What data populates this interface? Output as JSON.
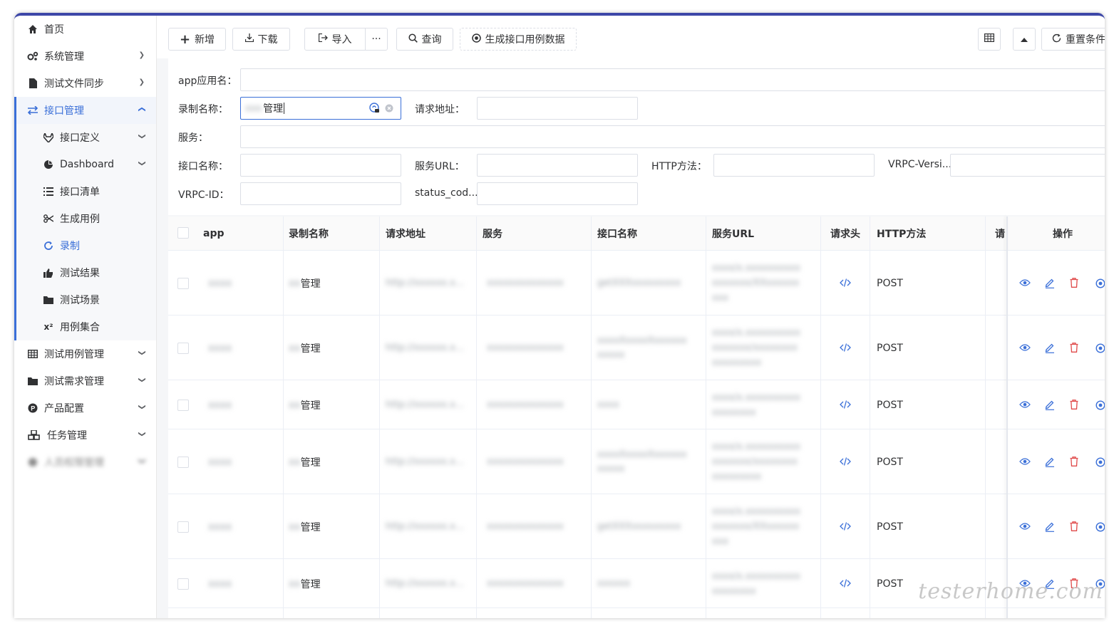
{
  "sidebar": {
    "items": [
      {
        "label": "首页",
        "icon": "home-icon"
      },
      {
        "label": "系统管理",
        "icon": "gears-icon"
      },
      {
        "label": "测试文件同步",
        "icon": "file-icon"
      },
      {
        "label": "接口管理",
        "icon": "exchange-icon"
      },
      {
        "label": "接口定义",
        "icon": "gitlab-icon"
      },
      {
        "label": "Dashboard",
        "icon": "pie-chart-icon"
      },
      {
        "label": "接口清单",
        "icon": "list-icon"
      },
      {
        "label": "生成用例",
        "icon": "scissors-icon"
      },
      {
        "label": "录制",
        "icon": "refresh-icon"
      },
      {
        "label": "测试结果",
        "icon": "thumbs-up-icon"
      },
      {
        "label": "测试场景",
        "icon": "folder-icon"
      },
      {
        "label": "用例集合",
        "icon": "superscript-icon"
      },
      {
        "label": "测试用例管理",
        "icon": "table-icon"
      },
      {
        "label": "测试需求管理",
        "icon": "folder-icon"
      },
      {
        "label": "产品配置",
        "icon": "product-hunt-icon"
      },
      {
        "label": "任务管理",
        "icon": "cubes-icon"
      },
      {
        "label": "人员权限管理",
        "icon": "blurred-icon"
      }
    ]
  },
  "toolbar": {
    "add": "新增",
    "download": "下载",
    "import": "导入",
    "more": "···",
    "query": "查询",
    "generate": "生成接口用例数据",
    "reset": "重置条件"
  },
  "search": {
    "app_label": "app应用名：",
    "record_label": "录制名称：",
    "record_value": "管理",
    "record_prefix": "xxx",
    "url_label": "请求地址：",
    "service_label": "服务：",
    "iface_label": "接口名称：",
    "service_url_label": "服务URL：",
    "http_label": "HTTP方法：",
    "vrpc_ver_label": "VRPC-Versi...",
    "vrpc_id_label": "VRPC-ID：",
    "status_label": "status_cod..."
  },
  "table": {
    "headers": [
      "app",
      "录制名称",
      "请求地址",
      "服务",
      "接口名称",
      "服务URL",
      "请求头",
      "HTTP方法",
      "请",
      "操作"
    ],
    "rows": [
      {
        "app": "xxxx",
        "record_prefix": "xx",
        "record": "管理",
        "url": "http://xxxxxx.x...",
        "service": "xxxxxxxxxxxxxx",
        "iface": "getXXXxxxxxxxxx",
        "svc_url": [
          "xxxx/x.xxxxxxxxxx",
          "xxxxxxx/XXxxxxxx",
          "xxx"
        ],
        "method": "POST"
      },
      {
        "app": "xxxx",
        "record_prefix": "xx",
        "record": "管理",
        "url": "http://xxxxxx.x...",
        "service": "xxxxxxxxxxxxxx",
        "iface": [
          "xxxxXxxxxXxxxxxx",
          "xxxxx"
        ],
        "svc_url": [
          "xxxx/x.xxxxxxxxxx",
          "xxxxxxx/xxxxxxxx",
          "xxxxxxxxx"
        ],
        "method": "POST"
      },
      {
        "app": "xxxx",
        "record_prefix": "xx",
        "record": "管理",
        "url": "http://xxxxxx.x...",
        "service": "xxxxxxxxxxxxxx",
        "iface": "xxxx",
        "svc_url": [
          "xxxx/x.xxxxxxxxxx",
          "xxxxxxxx"
        ],
        "method": "POST"
      },
      {
        "app": "xxxx",
        "record_prefix": "xx",
        "record": "管理",
        "url": "http://xxxxxx.x...",
        "service": "xxxxxxxxxxxxxx",
        "iface": [
          "xxxxXxxxxXxxxxxx",
          "xxxxx"
        ],
        "svc_url": [
          "xxxx/x.xxxxxxxxxx",
          "xxxxxxx/xxxxxxxx",
          "xxxxxxxxx"
        ],
        "method": "POST"
      },
      {
        "app": "xxxx",
        "record_prefix": "xx",
        "record": "管理",
        "url": "http://xxxxxx.x...",
        "service": "xxxxxxxxxxxxxx",
        "iface": "getXXXxxxxxxxxx",
        "svc_url": [
          "xxxx/x.xxxxxxxxxx",
          "xxxxxxx/XXxxxxxx",
          "xxx"
        ],
        "method": "POST"
      },
      {
        "app": "xxxx",
        "record_prefix": "xx",
        "record": "管理",
        "url": "http://xxxxxx.x...",
        "service": "xxxxxxxxxxxxxx",
        "iface": "xxxxxx",
        "svc_url": [
          "xxxx/x.xxxxxxxxxx",
          "xxxxxxxx"
        ],
        "method": "POST"
      }
    ]
  },
  "watermark": "testerhome.com",
  "colors": {
    "accent": "#3a6fd8",
    "danger": "#e04a4a",
    "topbar": "#3d47a8"
  }
}
